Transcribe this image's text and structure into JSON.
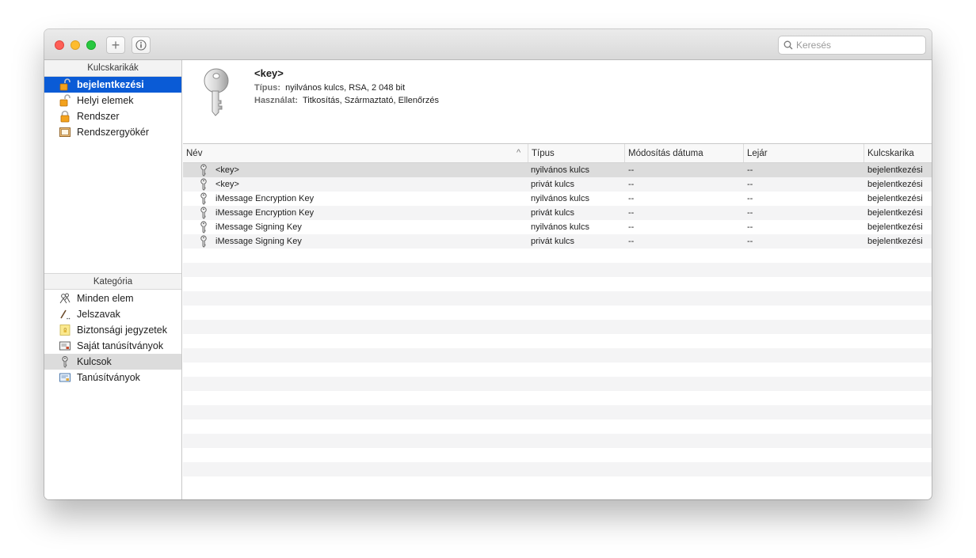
{
  "toolbar": {
    "search_placeholder": "Keresés"
  },
  "sidebar": {
    "keychains_header": "Kulcskarikák",
    "keychains": [
      {
        "label": "bejelentkezési",
        "icon": "lock-open-icon"
      },
      {
        "label": "Helyi elemek",
        "icon": "lock-open-icon"
      },
      {
        "label": "Rendszer",
        "icon": "lock-closed-icon"
      },
      {
        "label": "Rendszergyökér",
        "icon": "cabinet-icon"
      }
    ],
    "category_header": "Kategória",
    "categories": [
      {
        "label": "Minden elem",
        "icon": "people-icon"
      },
      {
        "label": "Jelszavak",
        "icon": "pen-icon"
      },
      {
        "label": "Biztonsági jegyzetek",
        "icon": "note-icon"
      },
      {
        "label": "Saját tanúsítványok",
        "icon": "certificate-icon"
      },
      {
        "label": "Kulcsok",
        "icon": "key-icon"
      },
      {
        "label": "Tanúsítványok",
        "icon": "certificate-icon"
      }
    ]
  },
  "detail": {
    "name": "<key>",
    "type_label": "Típus:",
    "type_value": "nyilvános kulcs, RSA, 2 048 bit",
    "usage_label": "Használat:",
    "usage_value": "Titkosítás, Származtató, Ellenőrzés"
  },
  "table": {
    "columns": [
      "Név",
      "Típus",
      "Módosítás dátuma",
      "Lejár",
      "Kulcskarika"
    ],
    "rows": [
      {
        "name": "<key>",
        "type": "nyilvános kulcs",
        "modified": "--",
        "expires": "--",
        "keychain": "bejelentkezési"
      },
      {
        "name": "<key>",
        "type": "privát kulcs",
        "modified": "--",
        "expires": "--",
        "keychain": "bejelentkezési"
      },
      {
        "name": "iMessage Encryption Key",
        "type": "nyilvános kulcs",
        "modified": "--",
        "expires": "--",
        "keychain": "bejelentkezési"
      },
      {
        "name": "iMessage Encryption Key",
        "type": "privát kulcs",
        "modified": "--",
        "expires": "--",
        "keychain": "bejelentkezési"
      },
      {
        "name": "iMessage Signing Key",
        "type": "nyilvános kulcs",
        "modified": "--",
        "expires": "--",
        "keychain": "bejelentkezési"
      },
      {
        "name": "iMessage Signing Key",
        "type": "privát kulcs",
        "modified": "--",
        "expires": "--",
        "keychain": "bejelentkezési"
      }
    ]
  }
}
